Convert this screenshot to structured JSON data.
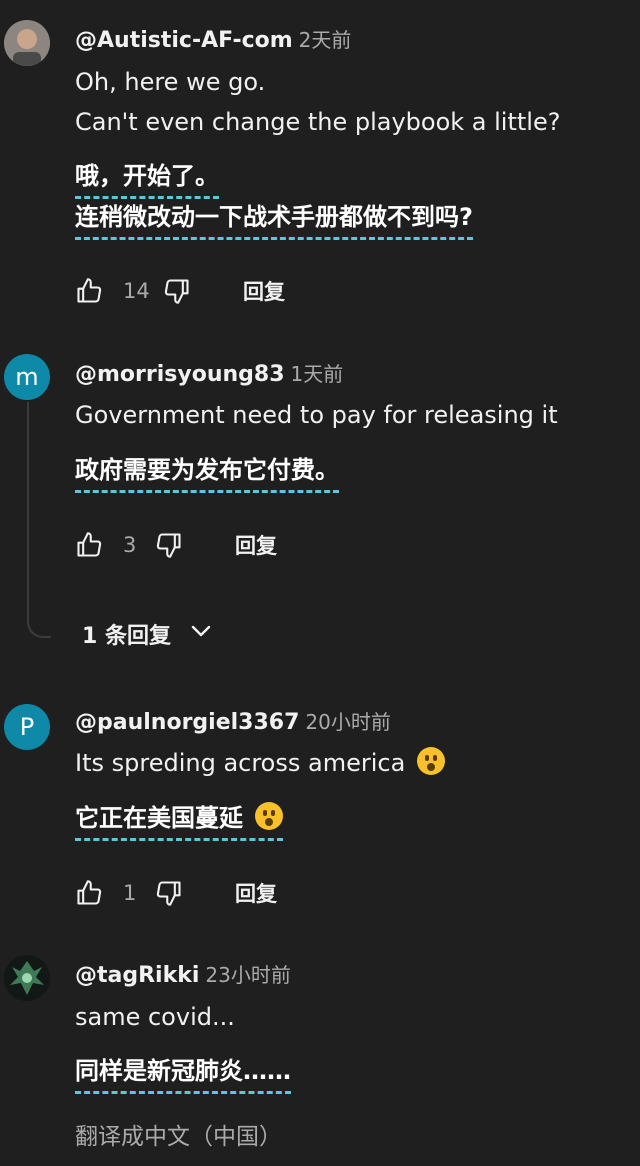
{
  "colors": {
    "background": "#1f1f1f",
    "avatar_letter_bg": "#0e8aa8",
    "translation_underline": "#5fc4dc",
    "secondary_text": "#aaaaaa"
  },
  "reply_label": "回复",
  "comments": [
    {
      "handle": "@Autistic-AF-com",
      "time": "2天前",
      "avatar": "photo",
      "text_lines": [
        "Oh, here we go.",
        "Can't even change the playbook a little?"
      ],
      "translation_lines": [
        "哦，开始了。",
        "连稍微改动一下战术手册都做不到吗?"
      ],
      "likes": "14",
      "emoji": ""
    },
    {
      "handle": "@morrisyoung83",
      "time": "1天前",
      "avatar": "letter",
      "avatar_letter": "m",
      "text_lines": [
        "Government need to pay for releasing it"
      ],
      "translation_lines": [
        "政府需要为发布它付费。"
      ],
      "likes": "3",
      "emoji": ""
    },
    {
      "handle": "@paulnorgiel3367",
      "time": "20小时前",
      "avatar": "letter",
      "avatar_letter": "P",
      "text_lines": [
        "Its spreding across america"
      ],
      "translation_lines": [
        "它正在美国蔓延"
      ],
      "likes": "1",
      "emoji": "hushed-face-emoji"
    },
    {
      "handle": "@tagRikki",
      "time": "23小时前",
      "avatar": "image",
      "text_lines": [
        "same covid..."
      ],
      "translation_lines": [
        "同样是新冠肺炎……"
      ],
      "likes": "",
      "emoji": ""
    }
  ],
  "replies_toggle": {
    "label": "1 条回复"
  },
  "translate_link": "翻译成中文（中国）"
}
